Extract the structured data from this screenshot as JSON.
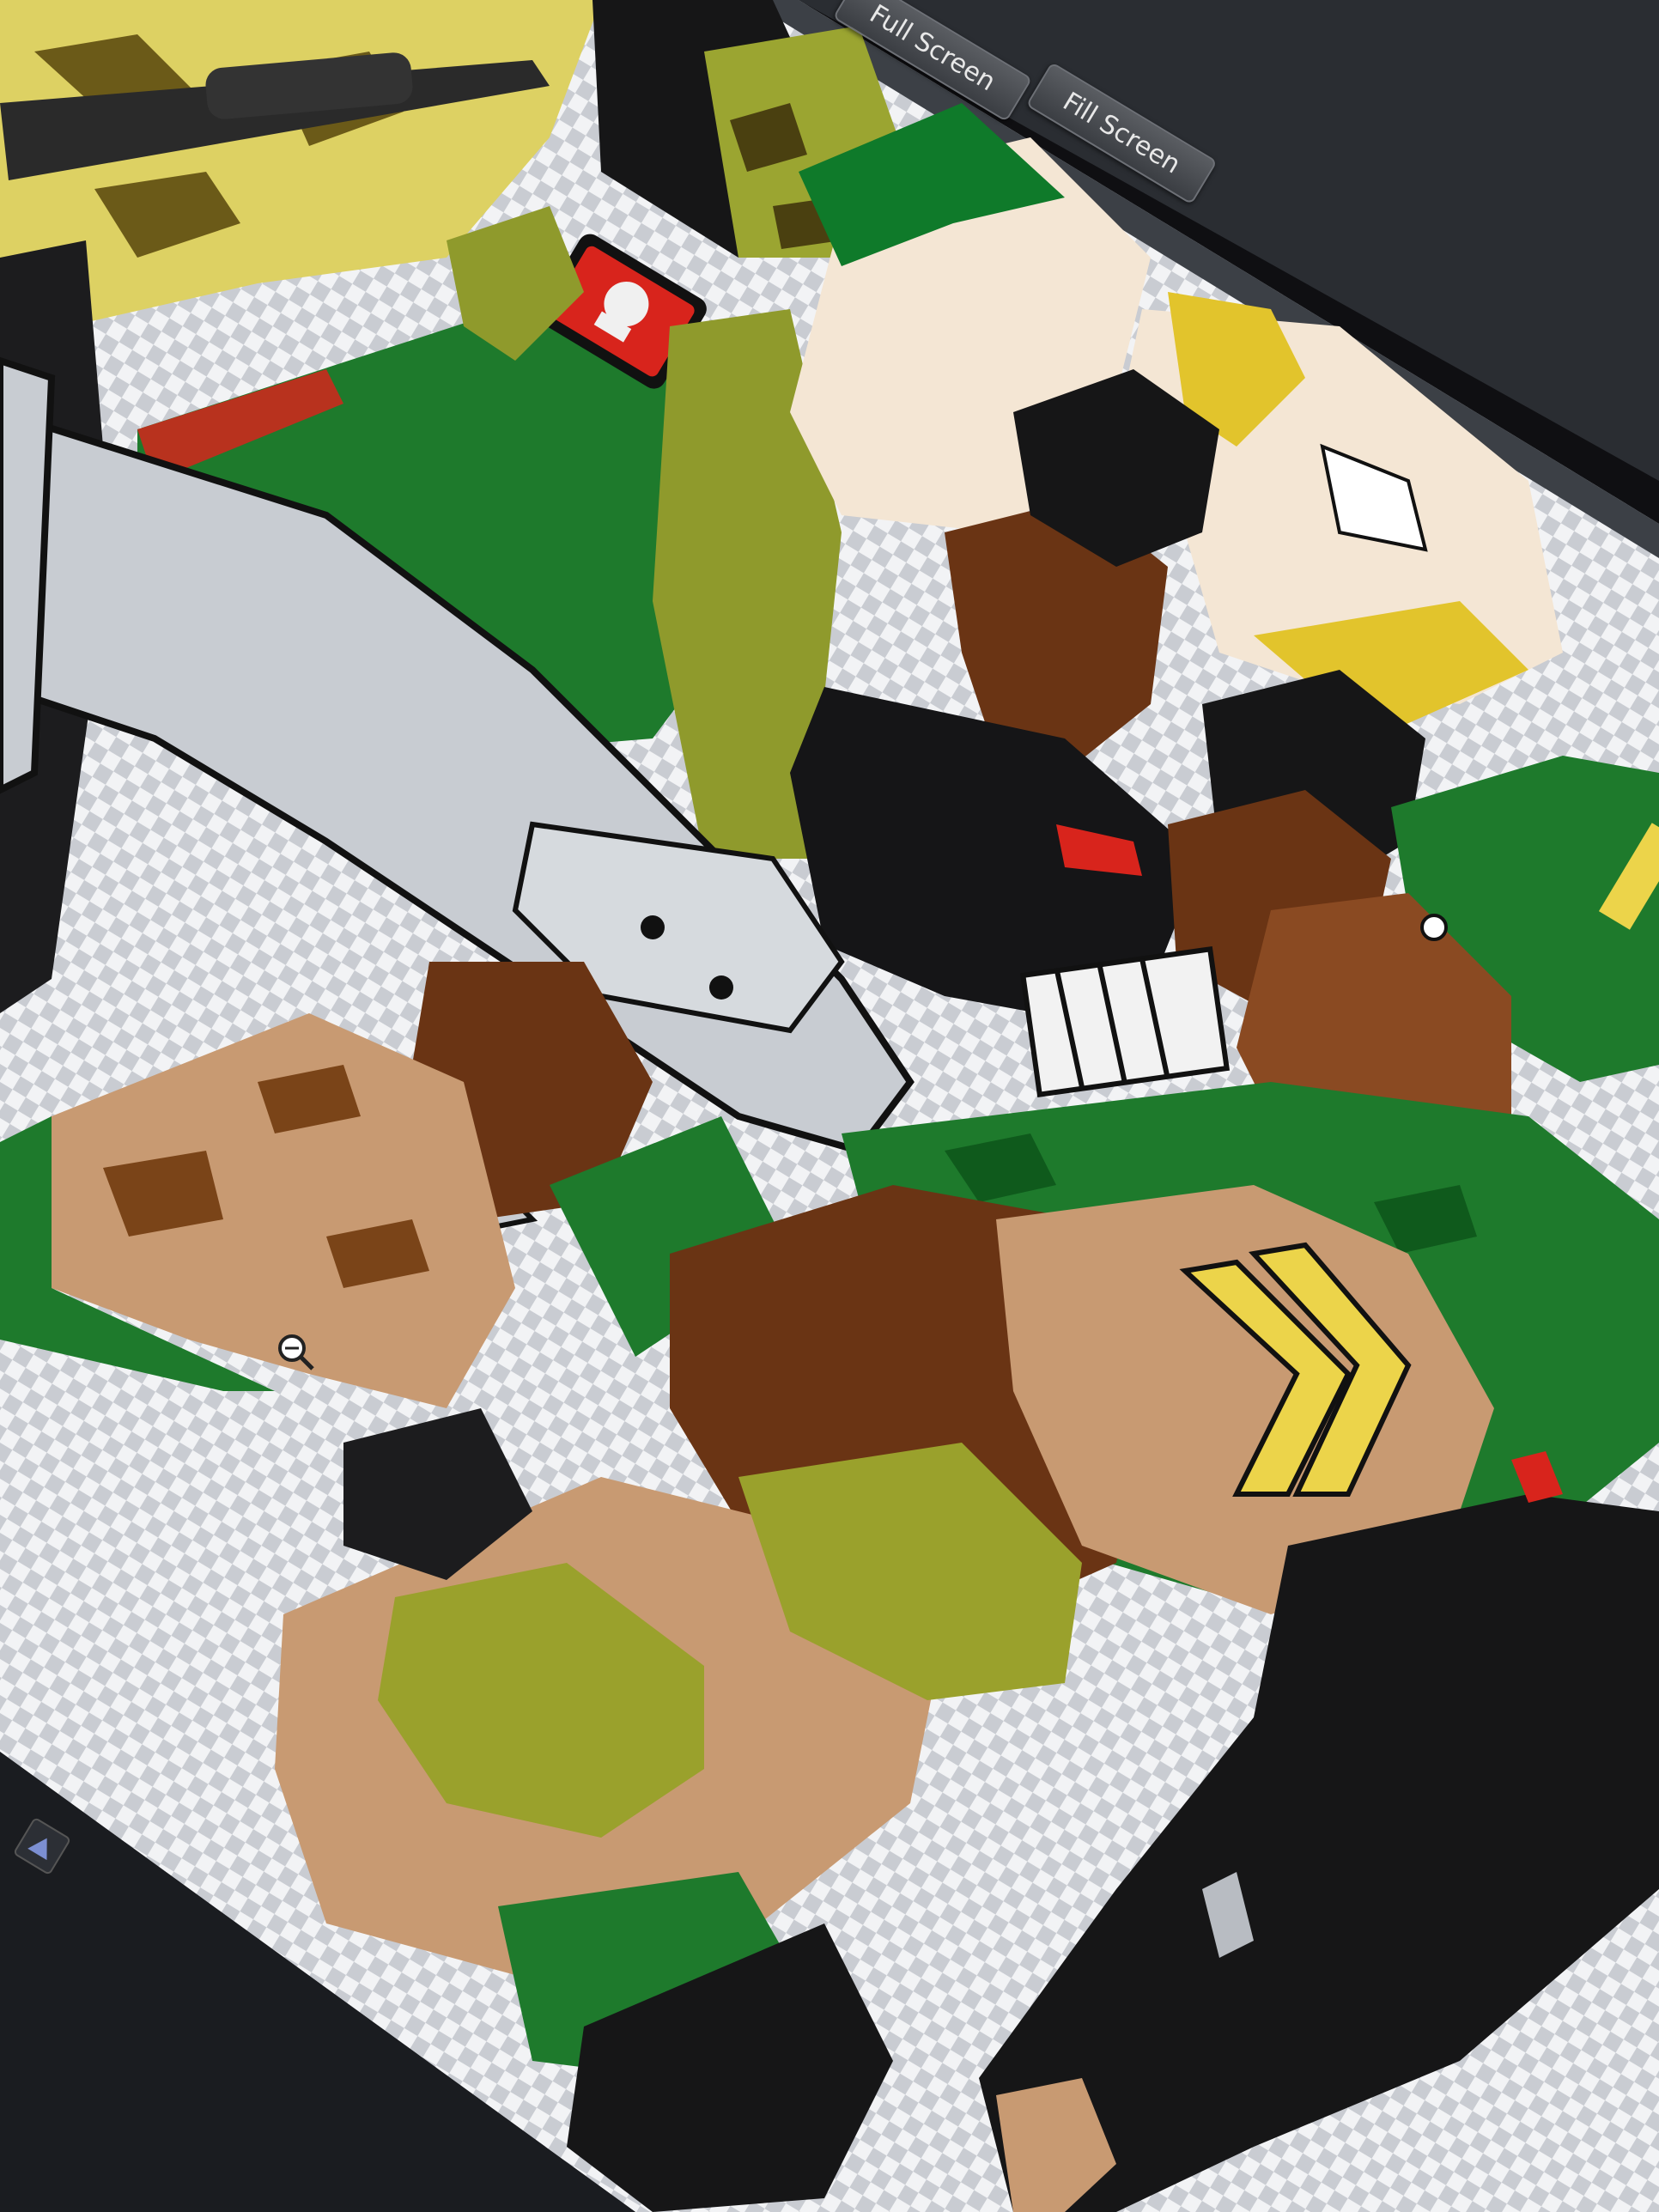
{
  "window": {
    "toolbar": {
      "full_screen_label": "Full Screen",
      "fill_screen_label": "Fill Screen"
    }
  },
  "canvas": {
    "background": "transparency-checkerboard",
    "artwork": "comic-style illustration of soldiers with rifle",
    "colors": {
      "green": "#1e7a2c",
      "dark_green": "#0f5a1c",
      "olive": "#8f9a2c",
      "khaki": "#c8bd4a",
      "skin_dark": "#6a3414",
      "skin_mid": "#8a4a22",
      "skin_tan": "#c89a72",
      "gun_grey": "#c8ccd2",
      "black": "#121214",
      "chevron_yellow": "#ecd44a",
      "patch_red": "#d8241c"
    }
  },
  "icons": {
    "zoom": "zoom-icon",
    "app": "app-icon"
  }
}
